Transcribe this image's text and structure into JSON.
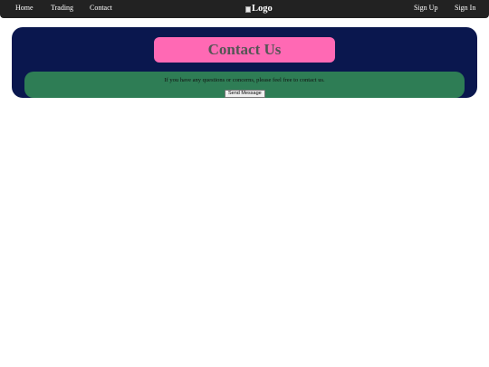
{
  "nav": {
    "left_links": [
      "Home",
      "Trading",
      "Contact"
    ],
    "logo_alt": "Logo",
    "right_links": [
      "Sign Up",
      "Sign In"
    ]
  },
  "contact": {
    "title": "Contact Us",
    "message": "If you have any questions or concerns, please feel free to contact us.",
    "button_label": "Send Message"
  },
  "colors": {
    "navbar": "#222222",
    "panel": "#0a174e",
    "title_box": "#ff69b4",
    "message_box": "#2e7d55"
  }
}
